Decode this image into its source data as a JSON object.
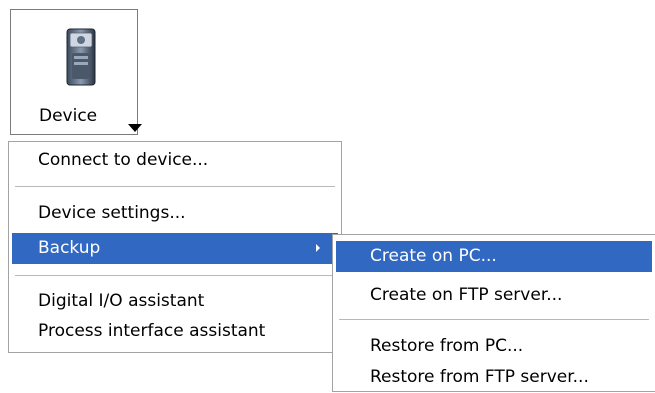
{
  "device_button": {
    "label": "Device",
    "icon": "device-camera-icon"
  },
  "main_menu": {
    "items": [
      {
        "label": "Connect to device..."
      },
      {
        "label": "Device settings..."
      },
      {
        "label": "Backup",
        "highlighted": true,
        "has_submenu": true
      },
      {
        "label": "Digital I/O assistant"
      },
      {
        "label": "Process interface assistant"
      }
    ]
  },
  "backup_submenu": {
    "items": [
      {
        "label": "Create on PC...",
        "highlighted": true
      },
      {
        "label": "Create on FTP server..."
      },
      {
        "label": "Restore from PC..."
      },
      {
        "label": "Restore from FTP server..."
      }
    ]
  },
  "colors": {
    "highlight": "#3168c2",
    "highlight_text": "#ffffff",
    "border": "#a3a3a3"
  }
}
